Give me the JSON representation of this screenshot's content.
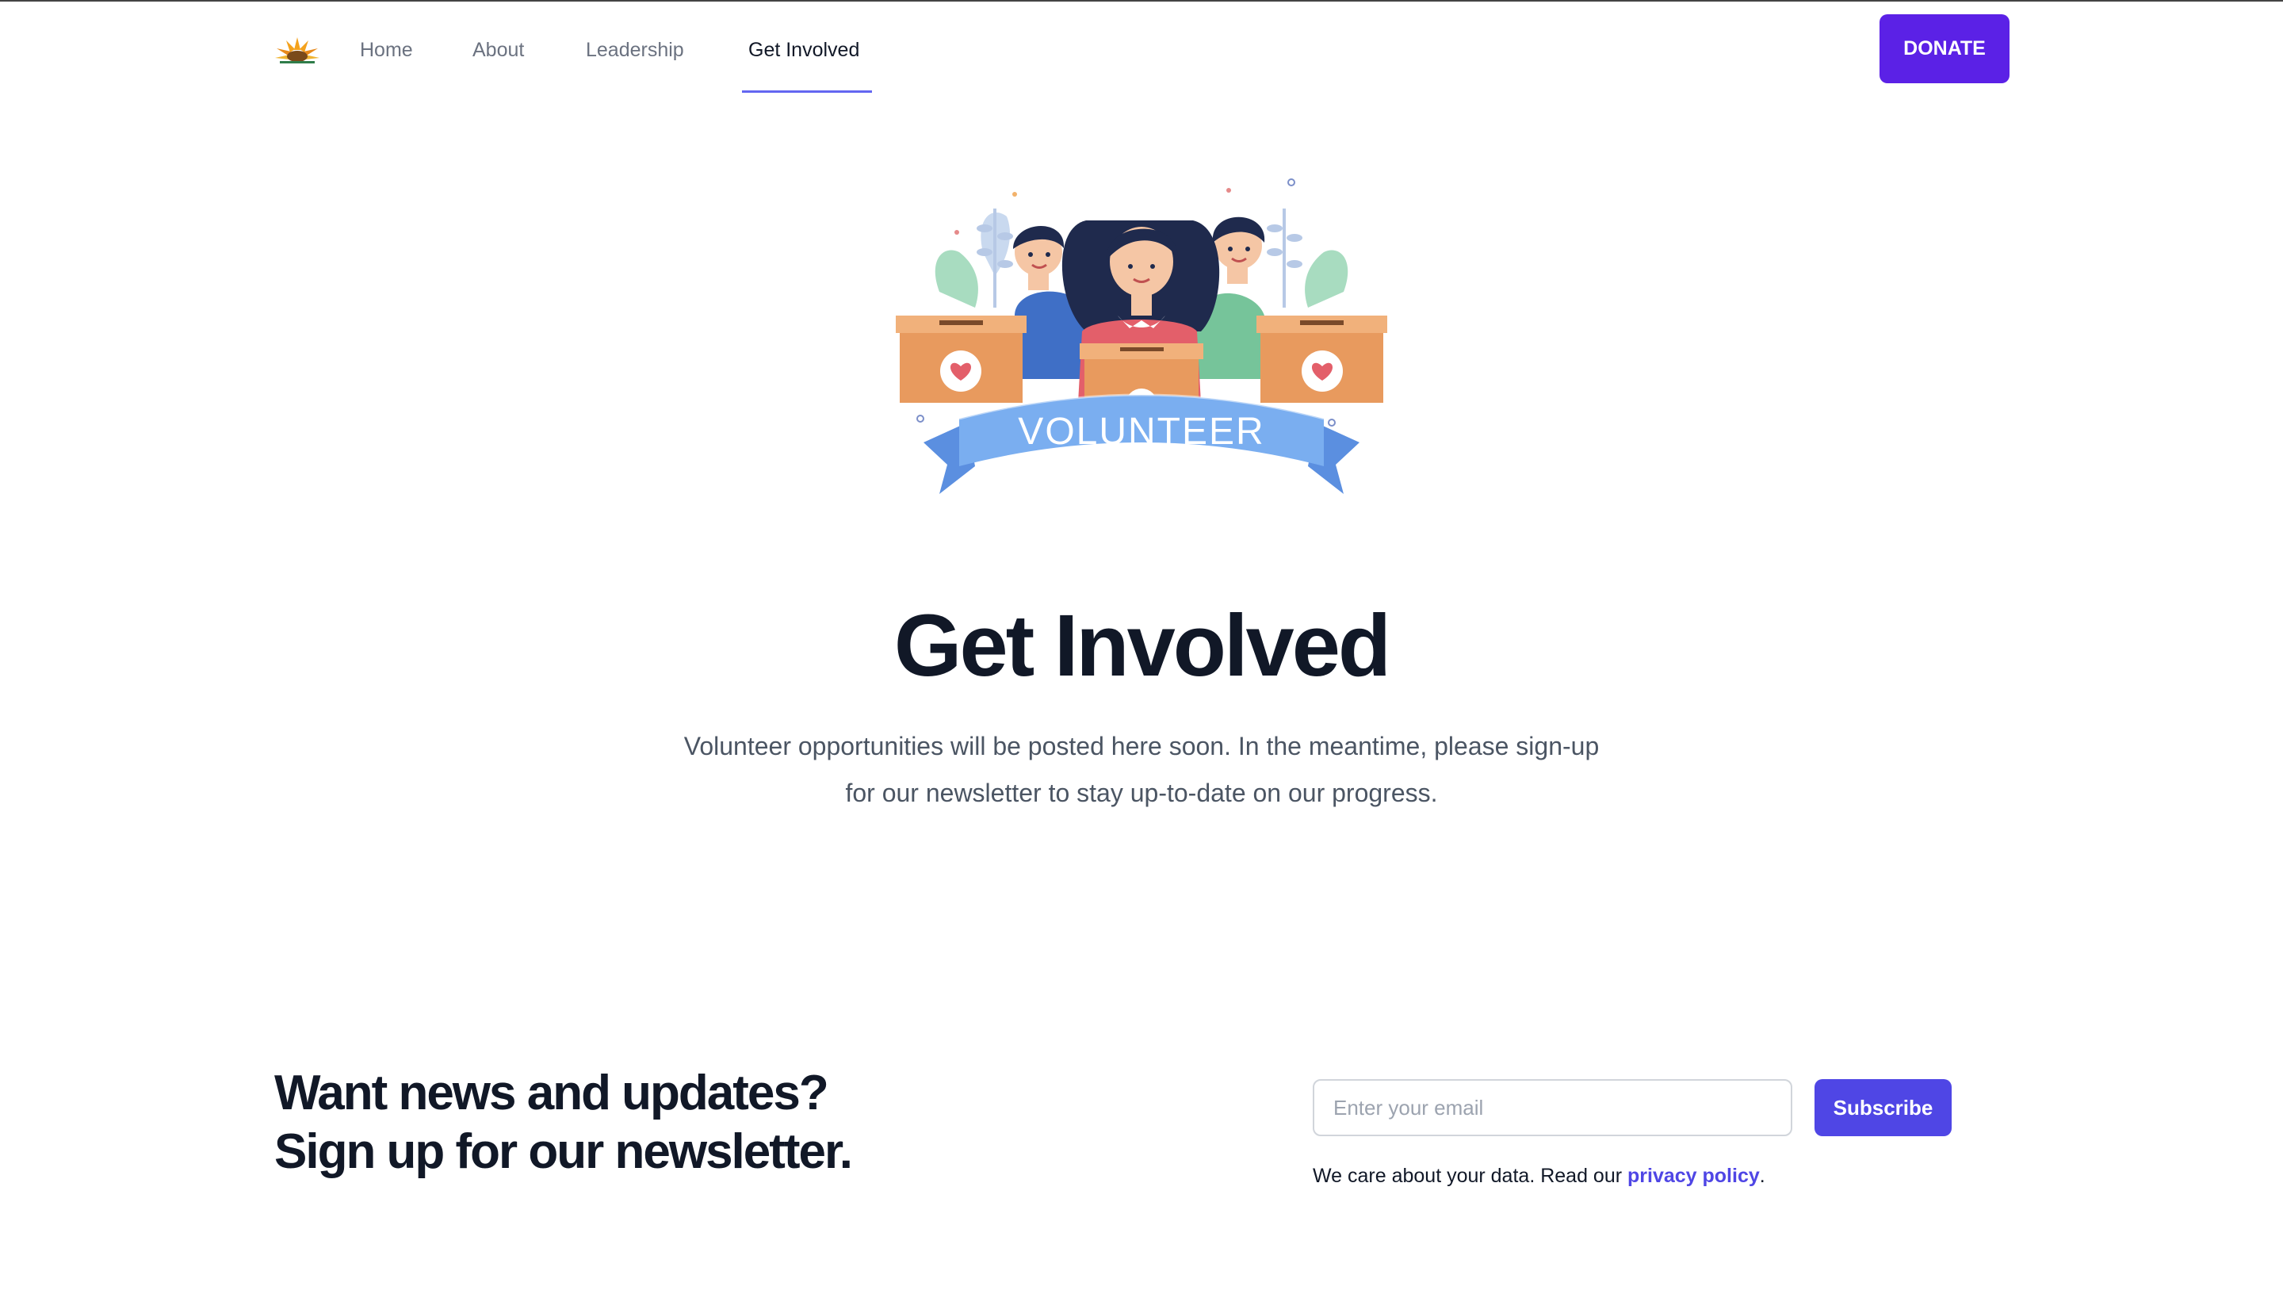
{
  "nav": {
    "logo_icon": "sunflower-logo-icon",
    "links": [
      {
        "label": "Home"
      },
      {
        "label": "About"
      },
      {
        "label": "Leadership"
      },
      {
        "label": "Get Involved",
        "active": true
      }
    ],
    "donate_label": "DONATE"
  },
  "hero": {
    "banner_text": "VOLUNTEER",
    "title": "Get Involved",
    "intro_line1": "Volunteer opportunities will be posted here soon. In the meantime, please sign-up",
    "intro_line2": "for our newsletter to stay up-to-date on our progress."
  },
  "newsletter": {
    "title_line1": "Want news and updates?",
    "title_line2": "Sign up for our newsletter.",
    "email_placeholder": "Enter your email",
    "email_value": "",
    "subscribe_label": "Subscribe",
    "privacy_prefix": "We care about your data. Read our ",
    "privacy_link": "privacy policy",
    "privacy_suffix": "."
  },
  "colors": {
    "accent": "#5b21e6",
    "subscribe": "#4f46e5",
    "nav_underline": "#6366f1",
    "banner": "#7aaef0"
  }
}
